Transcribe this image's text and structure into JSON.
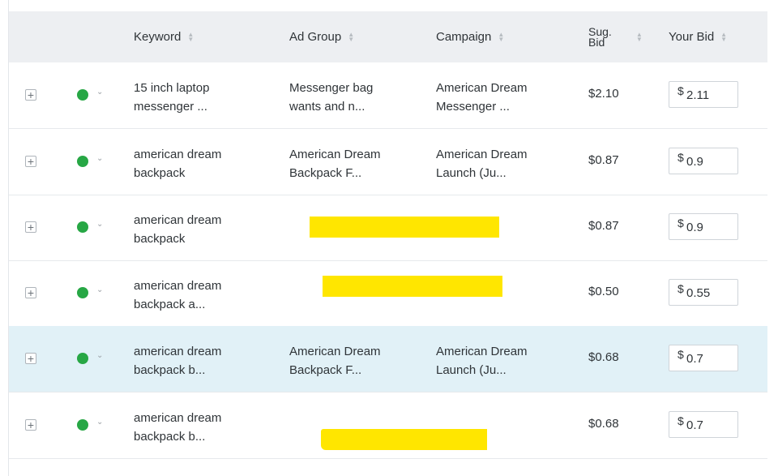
{
  "header": {
    "keyword": "Keyword",
    "ad_group": "Ad Group",
    "campaign": "Campaign",
    "sug_bid_line1": "Sug.",
    "sug_bid_line2": "Bid",
    "your_bid": "Your Bid"
  },
  "currency_symbol": "$",
  "expand_glyph": "+",
  "caret_glyph": "⌄",
  "status_color": "#27a745",
  "highlight_color": "#e1f1f7",
  "redaction_color": "#ffe600",
  "rows": [
    {
      "keyword": [
        "15 inch laptop",
        "messenger ..."
      ],
      "ad_group": [
        "Messenger bag",
        "wants and n..."
      ],
      "campaign": [
        "American Dream",
        "Messenger ..."
      ],
      "sug_bid": "$2.10",
      "your_bid": "2.11"
    },
    {
      "keyword": [
        "american dream",
        "backpack"
      ],
      "ad_group": [
        "American Dream",
        "Backpack F..."
      ],
      "campaign": [
        "American Dream",
        "Launch (Ju..."
      ],
      "sug_bid": "$0.87",
      "your_bid": "0.9"
    },
    {
      "keyword": [
        "american dream",
        "backpack"
      ],
      "sug_bid": "$0.87",
      "your_bid": "0.9"
    },
    {
      "keyword": [
        "american dream",
        "backpack a..."
      ],
      "sug_bid": "$0.50",
      "your_bid": "0.55"
    },
    {
      "keyword": [
        "american dream",
        "backpack b..."
      ],
      "ad_group": [
        "American Dream",
        "Backpack F..."
      ],
      "campaign": [
        "American Dream",
        "Launch (Ju..."
      ],
      "sug_bid": "$0.68",
      "your_bid": "0.7"
    },
    {
      "keyword": [
        "american dream",
        "backpack b..."
      ],
      "sug_bid": "$0.68",
      "your_bid": "0.7"
    }
  ]
}
